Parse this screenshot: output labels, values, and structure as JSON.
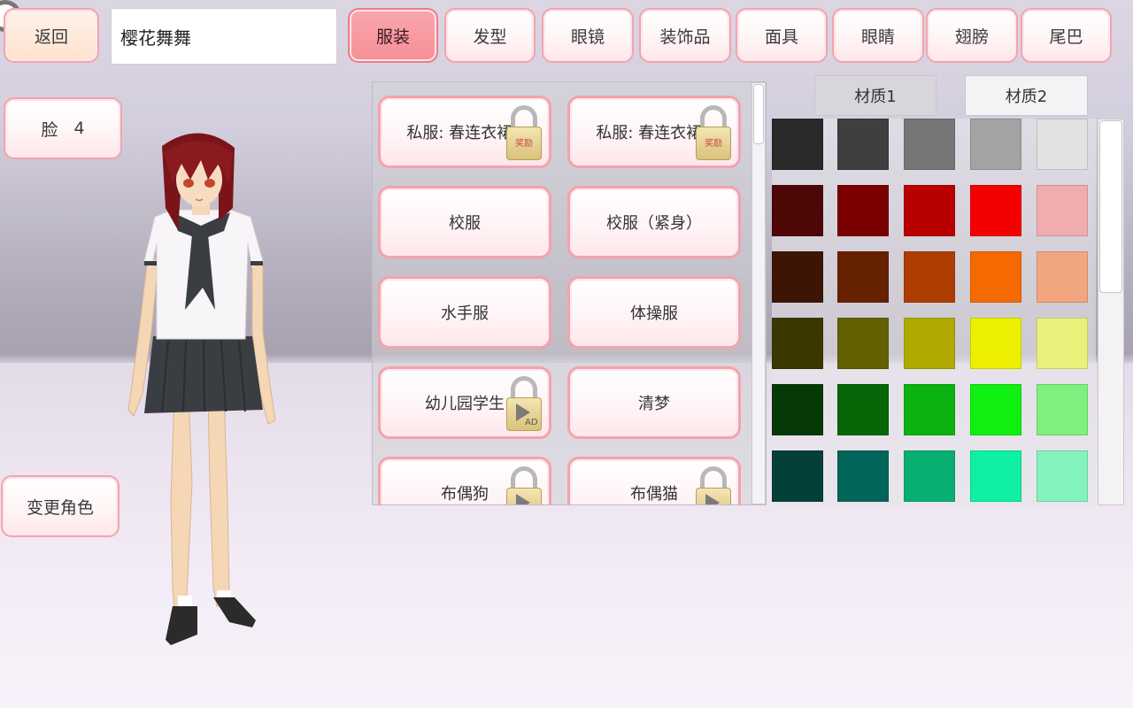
{
  "header": {
    "back_label": "返回",
    "name_value": "樱花舞舞",
    "categories": [
      "服装",
      "发型",
      "眼镜",
      "装饰品",
      "面具",
      "眼睛",
      "翅膀",
      "尾巴"
    ],
    "active_category": "服装"
  },
  "face": {
    "label": "脸",
    "value": "4"
  },
  "change_character_label": "变更角色",
  "clothes": [
    {
      "label": "私服: 春连衣裙1",
      "lock": "reward",
      "lock_text": "奖励"
    },
    {
      "label": "私服: 春连衣裙2",
      "lock": "reward",
      "lock_text": "奖励"
    },
    {
      "label": "校服",
      "lock": "none"
    },
    {
      "label": "校服（紧身）",
      "lock": "none"
    },
    {
      "label": "水手服",
      "lock": "none"
    },
    {
      "label": "体操服",
      "lock": "none"
    },
    {
      "label": "幼儿园学生",
      "lock": "ad",
      "lock_text": "AD"
    },
    {
      "label": "清梦",
      "lock": "none"
    },
    {
      "label": "布偶狗",
      "lock": "ad",
      "lock_text": ""
    },
    {
      "label": "布偶猫",
      "lock": "ad",
      "lock_text": ""
    }
  ],
  "material_tabs": {
    "tab1": "材质1",
    "tab2": "材质2",
    "active": "材质1"
  },
  "swatch_colors": [
    [
      "#2a2a2a",
      "#3f3f3f",
      "#767676",
      "#a3a3a3",
      "#e2e2e2"
    ],
    [
      "#4d0707",
      "#7a0000",
      "#b80000",
      "#f50000",
      "#f1acaf"
    ],
    [
      "#3e1504",
      "#662200",
      "#ae3d02",
      "#f56a00",
      "#f2a680"
    ],
    [
      "#3b3702",
      "#636000",
      "#b0aa00",
      "#edef00",
      "#eaf07a"
    ],
    [
      "#053a06",
      "#066506",
      "#0cb20f",
      "#10f010",
      "#7ff07e"
    ],
    [
      "#053f39",
      "#03655a",
      "#08ae72",
      "#0ff0a2",
      "#85f3bd"
    ]
  ],
  "colors": {
    "accent_pink": "#f58f97",
    "border_pink": "#f2a4ad"
  }
}
